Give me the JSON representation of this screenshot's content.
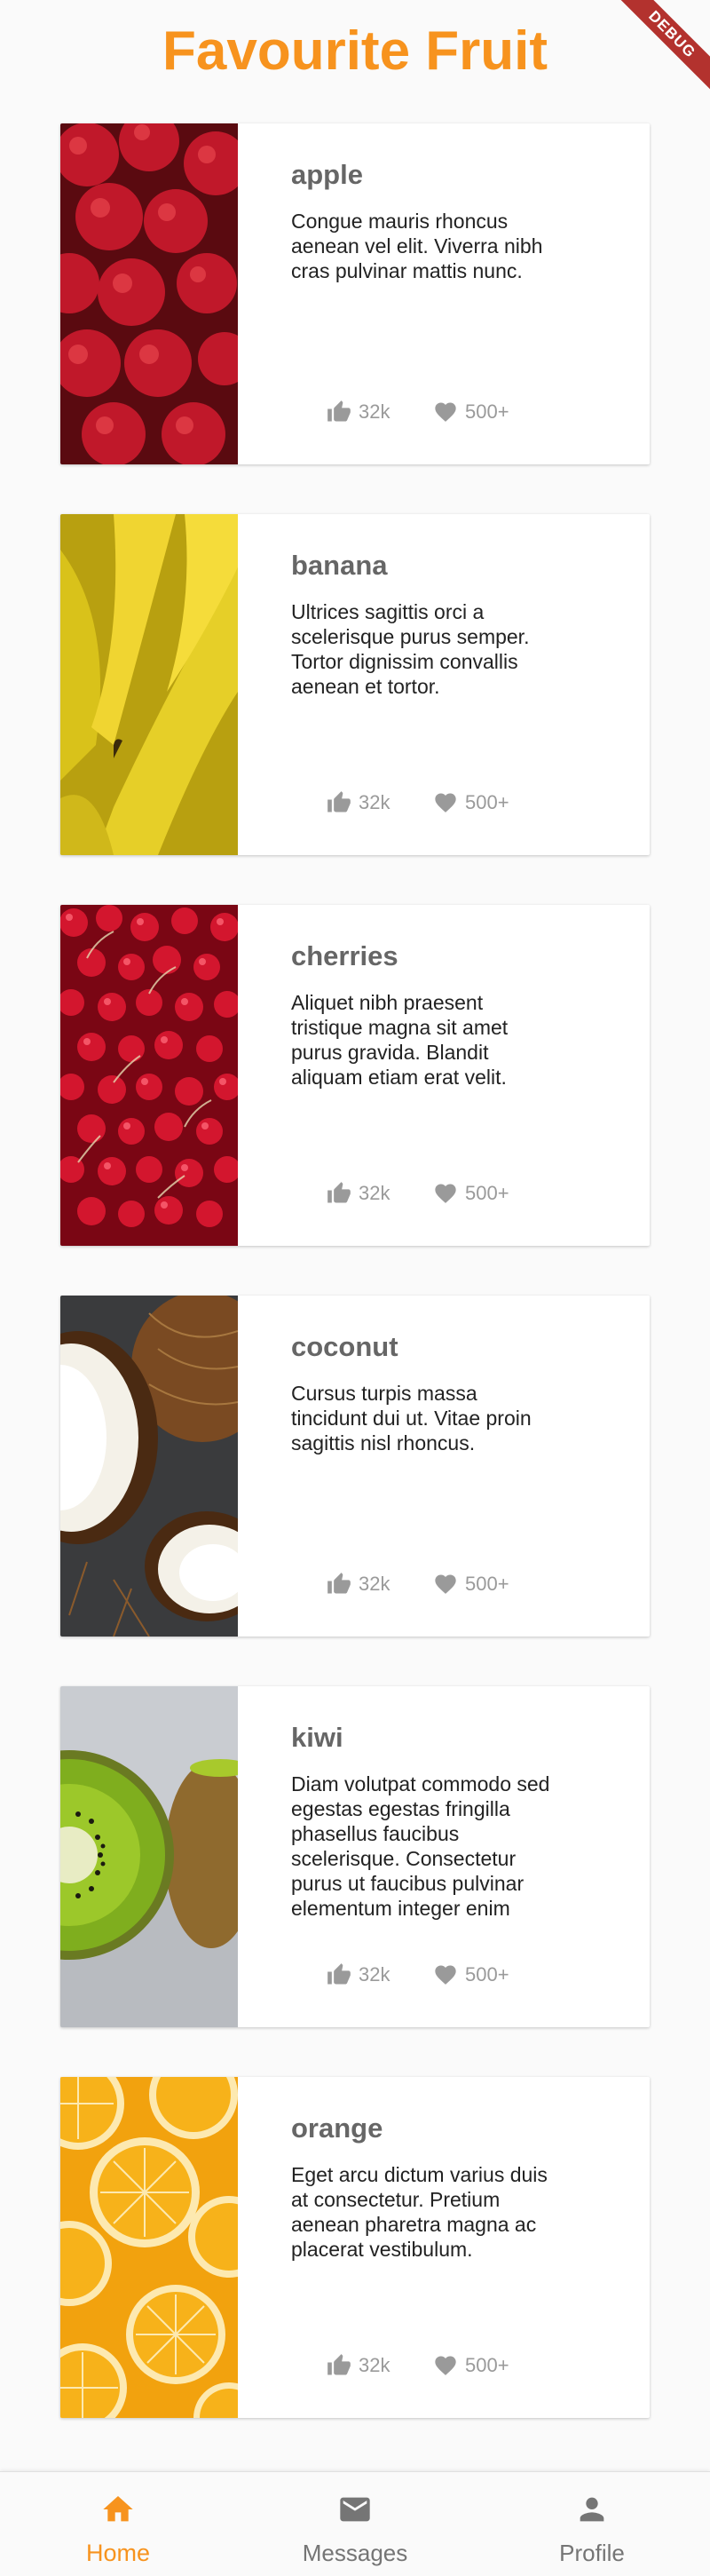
{
  "app": {
    "title": "Favourite Fruit",
    "debug_banner": "DEBUG"
  },
  "cards": [
    {
      "name": "apple",
      "description": "Congue mauris rhoncus aenean vel elit. Viverra nibh cras pulvinar mattis nunc.",
      "likes": "32k",
      "favorites": "500+"
    },
    {
      "name": "banana",
      "description": "Ultrices sagittis orci a scelerisque purus semper. Tortor dignissim convallis aenean et tortor.",
      "likes": "32k",
      "favorites": "500+"
    },
    {
      "name": "cherries",
      "description": "Aliquet nibh praesent tristique magna sit amet purus gravida. Blandit aliquam etiam erat velit.",
      "likes": "32k",
      "favorites": "500+"
    },
    {
      "name": "coconut",
      "description": "Cursus turpis massa tincidunt dui ut. Vitae proin sagittis nisl rhoncus.",
      "likes": "32k",
      "favorites": "500+"
    },
    {
      "name": "kiwi",
      "description": "Diam volutpat commodo sed egestas egestas fringilla phasellus faucibus scelerisque. Consectetur purus ut faucibus pulvinar elementum integer enim",
      "likes": "32k",
      "favorites": "500+"
    },
    {
      "name": "orange",
      "description": "Eget arcu dictum varius duis at consectetur. Pretium aenean pharetra magna ac placerat vestibulum.",
      "likes": "32k",
      "favorites": "500+"
    }
  ],
  "icons": {
    "like": "thumb-up-icon",
    "favorite": "heart-icon",
    "home": "home-icon",
    "messages": "mail-icon",
    "profile": "person-icon"
  },
  "bottom_nav": {
    "items": [
      {
        "label": "Home",
        "active": true
      },
      {
        "label": "Messages",
        "active": false
      },
      {
        "label": "Profile",
        "active": false
      }
    ]
  },
  "colors": {
    "accent": "#f7931e",
    "inactive": "#757575",
    "stat": "#9a9a9a",
    "debug": "#b3322e"
  }
}
